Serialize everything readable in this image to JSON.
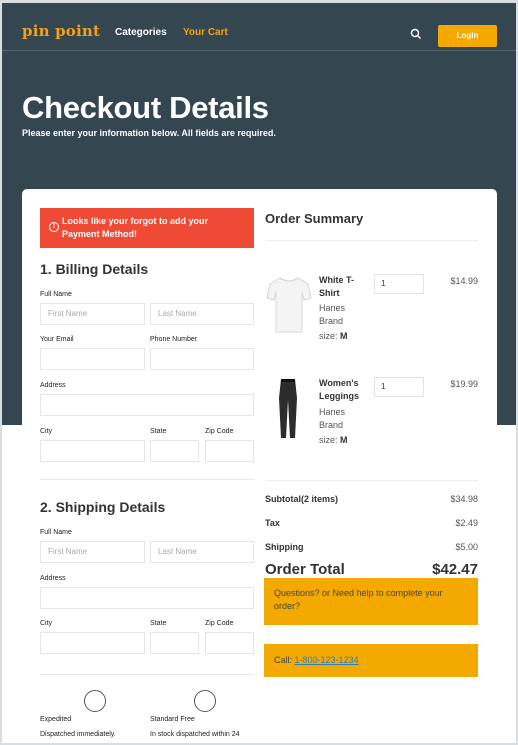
{
  "nav": {
    "logo": "pin point",
    "categories": "Categories",
    "cart": "Your Cart",
    "search_icon": "search-icon",
    "login": "Login"
  },
  "hero": {
    "title": "Checkout Details",
    "subtitle": "Please enter your information below. All fields are required."
  },
  "alert": {
    "icon": "info-icon",
    "text": "Looks like your forgot to add your Payment Method!",
    "color": "#ef4a36"
  },
  "billing": {
    "title": "1. Billing Details",
    "full_name_label": "Full Name",
    "first_name_placeholder": "First Name",
    "last_name_placeholder": "Last Name",
    "email_label": "Your Email",
    "phone_label": "Phone Number",
    "address_label": "Address",
    "city_label": "City",
    "state_label": "State",
    "zip_label": "Zip Code"
  },
  "shipping": {
    "title": "2. Shipping Details",
    "full_name_label": "Full Name",
    "first_name_placeholder": "First Name",
    "last_name_placeholder": "Last Name",
    "address_label": "Address",
    "city_label": "City",
    "state_label": "State",
    "zip_label": "Zip Code",
    "options": [
      {
        "name": "Expedited",
        "desc": "Dispatched immediately."
      },
      {
        "name": "Standard Free",
        "desc": "In stock dispatched within 24"
      }
    ]
  },
  "summary": {
    "title": "Order Summary",
    "items": [
      {
        "name": "White T-Shirt",
        "brand": "Hanes Brand",
        "size_label": "size:",
        "size": "M",
        "qty": "1",
        "price": "$14.99",
        "image": "white-tshirt-image"
      },
      {
        "name": "Women's Leggings",
        "brand": "Hanes Brand",
        "size_label": "size:",
        "size": "M",
        "qty": "1",
        "price": "$19.99",
        "image": "leggings-image"
      }
    ],
    "subtotal_label": "Subtotal(2 items)",
    "subtotal": "$34.98",
    "tax_label": "Tax",
    "tax": "$2.49",
    "shipping_label": "Shipping",
    "shipping": "$5.00",
    "total_label": "Order Total",
    "total": "$42.47"
  },
  "help": {
    "text": "Questions? or Need help to complete your order?",
    "call_label": "Call:",
    "phone": "1-800-123-1234"
  },
  "colors": {
    "hero_bg": "#344750",
    "accent": "#f4a900",
    "logo": "#f4a11a",
    "alert": "#ef4a36"
  }
}
